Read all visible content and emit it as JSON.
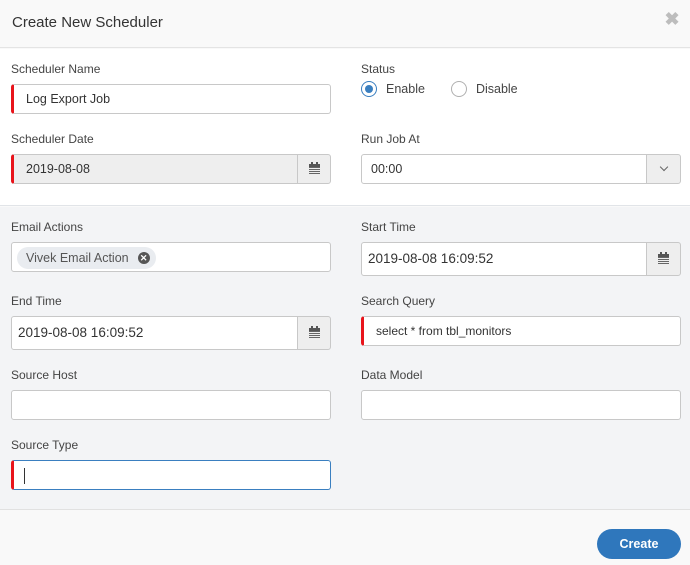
{
  "dialog": {
    "title": "Create New Scheduler",
    "close_icon": "close-icon"
  },
  "form": {
    "scheduler_name": {
      "label": "Scheduler Name",
      "value": "Log Export Job"
    },
    "status": {
      "label": "Status",
      "options": [
        {
          "label": "Enable",
          "selected": true
        },
        {
          "label": "Disable",
          "selected": false
        }
      ]
    },
    "scheduler_date": {
      "label": "Scheduler Date",
      "value": "2019-08-08",
      "icon": "calendar-icon"
    },
    "run_job_at": {
      "label": "Run Job At",
      "value": "00:00",
      "icon": "chevron-down-icon"
    },
    "email_actions": {
      "label": "Email Actions",
      "chips": [
        "Vivek Email Action"
      ]
    },
    "start_time": {
      "label": "Start Time",
      "value": "2019-08-08 16:09:52",
      "icon": "calendar-icon"
    },
    "end_time": {
      "label": "End Time",
      "value": "2019-08-08 16:09:52",
      "icon": "calendar-icon"
    },
    "search_query": {
      "label": "Search Query",
      "value": "select * from tbl_monitors"
    },
    "source_host": {
      "label": "Source Host",
      "value": ""
    },
    "data_model": {
      "label": "Data Model",
      "value": ""
    },
    "source_type": {
      "label": "Source Type",
      "value": ""
    }
  },
  "footer": {
    "create_label": "Create"
  },
  "colors": {
    "accent": "#2f77bc",
    "required": "#e8141b"
  }
}
